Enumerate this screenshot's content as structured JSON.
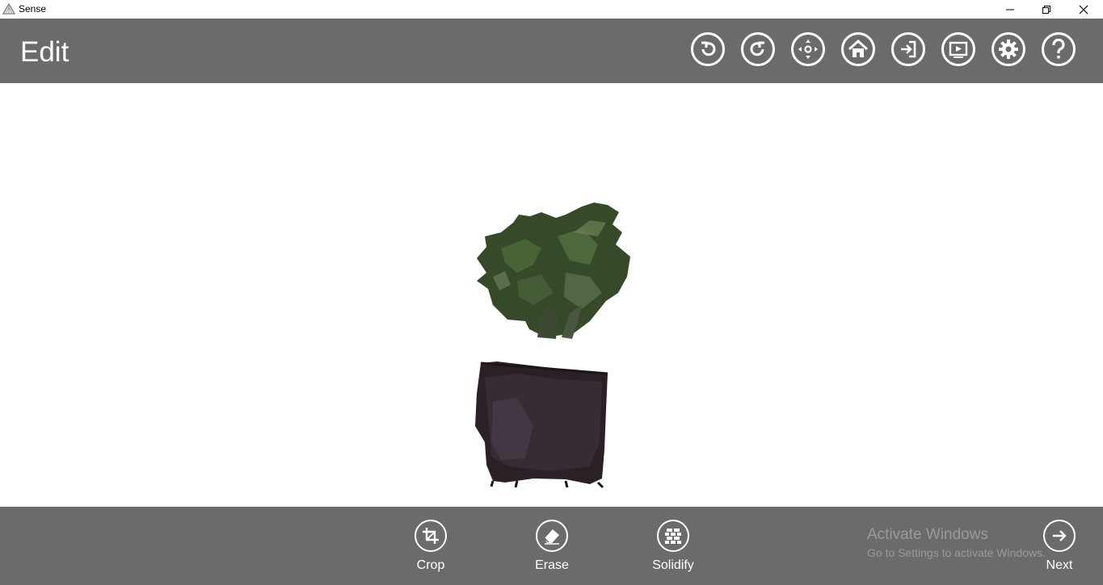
{
  "window": {
    "app_name": "Sense",
    "icon": "sense-app-icon",
    "controls": [
      "minimize-icon",
      "restore-icon",
      "close-icon"
    ]
  },
  "header": {
    "title": "Edit",
    "tools": [
      {
        "name": "undo-icon"
      },
      {
        "name": "redo-icon"
      },
      {
        "name": "move-view-icon"
      },
      {
        "name": "home-icon"
      },
      {
        "name": "export-icon"
      },
      {
        "name": "play-icon"
      },
      {
        "name": "settings-gear-icon"
      },
      {
        "name": "help-icon"
      }
    ]
  },
  "viewport": {
    "model": "3D scan of potted plant"
  },
  "actions": {
    "crop": {
      "label": "Crop",
      "icon": "crop-icon"
    },
    "erase": {
      "label": "Erase",
      "icon": "eraser-icon"
    },
    "solidify": {
      "label": "Solidify",
      "icon": "solidify-icon"
    },
    "next": {
      "label": "Next",
      "icon": "arrow-right-icon"
    }
  },
  "watermark": {
    "title": "Activate Windows",
    "subtitle": "Go to Settings to activate Windows."
  },
  "colors": {
    "bar": "#6b6b6b",
    "canvas": "#ffffff",
    "foreground": "#ffffff"
  }
}
